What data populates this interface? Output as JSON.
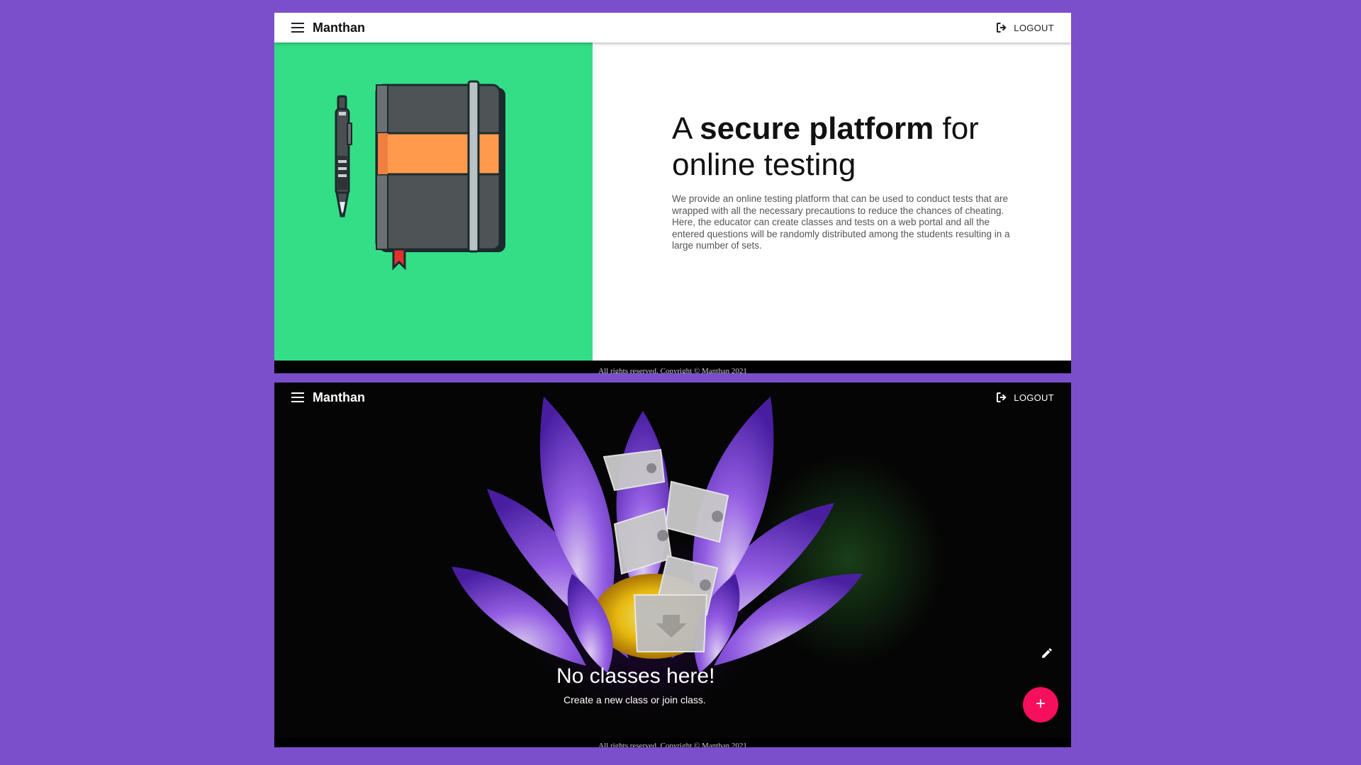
{
  "top_panel": {
    "appbar": {
      "title": "Manthan",
      "logout_label": "LOGOUT"
    },
    "hero": {
      "headline_prefix": "A ",
      "headline_bold": "secure platform",
      "headline_suffix": " for online testing",
      "description": "We provide an online testing platform that can be used to conduct tests that are wrapped with all the necessary precautions to reduce the chances of cheating. Here, the educator can create classes and tests on a web portal and all the entered questions will be randomly distributed among the students resulting in a large number of sets.",
      "left_background": "#33de87"
    },
    "footer": "All rights reserved. Copyright © Manthan 2021"
  },
  "bottom_panel": {
    "appbar": {
      "title": "Manthan",
      "logout_label": "LOGOUT"
    },
    "empty_state": {
      "title": "No classes here!",
      "subtitle": "Create a new class or join class."
    },
    "fab_label": "+",
    "footer": "All rights reserved. Copyright © Manthan 2021"
  },
  "colors": {
    "page_background": "#7b4fcb",
    "fab": "#f50f5c",
    "notebook_band": "#ff9a4d",
    "notebook_cover": "#4e5456"
  }
}
